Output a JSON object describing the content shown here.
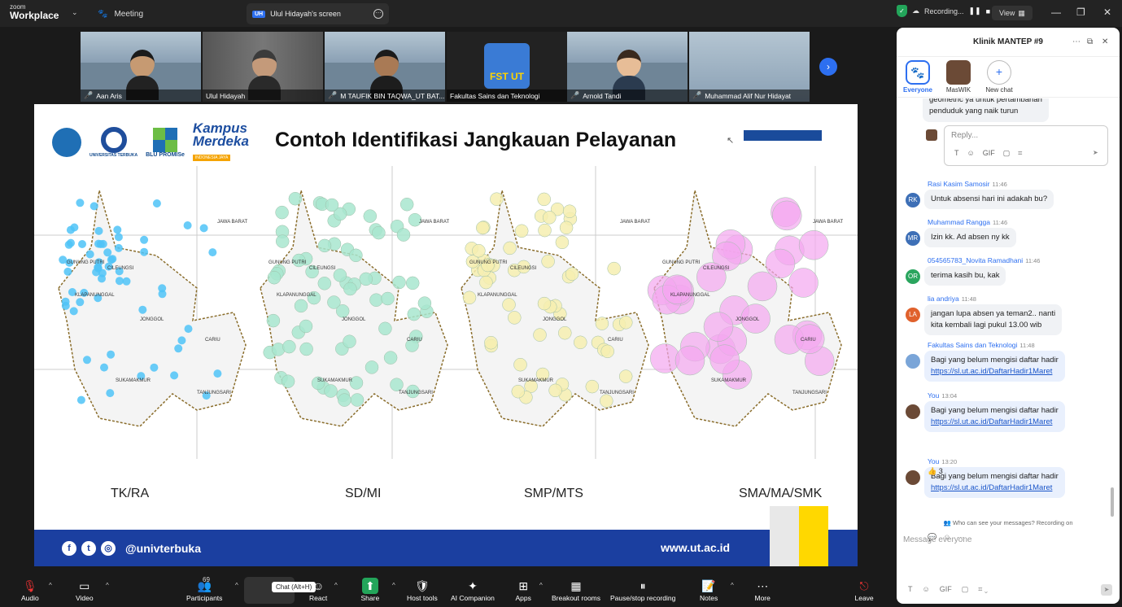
{
  "titlebar": {
    "logo_small": "zoom",
    "logo_big": "Workplace",
    "meeting_label": "Meeting",
    "screen_badge": "UH",
    "screen_tab": "Ulul Hidayah's screen",
    "recording_label": "Recording...",
    "view_label": "View",
    "icons": [
      "paw-icon",
      "shield-check-icon",
      "cloud-icon",
      "pause-icon",
      "stop-icon",
      "minimize-icon",
      "restore-icon",
      "close-icon"
    ]
  },
  "participants": [
    {
      "name": "Aan Aris",
      "muted": true
    },
    {
      "name": "Ulul Hidayah",
      "muted": false
    },
    {
      "name": "M TAUFIK BIN TAQWA_UT BAT...",
      "muted": true
    },
    {
      "name": "Fakultas Sains dan Teknologi",
      "muted": false
    },
    {
      "name": "Arnold Tandi",
      "muted": true
    },
    {
      "name": "Muhammad Alif Nur Hidayat",
      "muted": true
    }
  ],
  "fst_logo_text": "FST UT",
  "slide": {
    "title": "Contoh Identifikasi Jangkauan Pelayanan",
    "logo_labels": [
      "UNIVERSITAS TERBUKA",
      "BLU PROMISe"
    ],
    "kampus_logo": "Kampus",
    "merdeka_logo": "Merdeka",
    "kampus_sub": "INDONESIA JAYA",
    "map_labels": [
      "TK/RA",
      "SD/MI",
      "SMP/MTS",
      "SMA/MA/SMK"
    ],
    "footer_handle": "@univterbuka",
    "footer_web": "www.ut.ac.id",
    "place_names": [
      "GUNUNG PUTRI",
      "CILEUNGSI",
      "KLAPANUNGGAL",
      "JONGGOL",
      "CARIU",
      "SUKAMAKMUR",
      "TANJUNGSARI",
      "JAWA BARAT"
    ],
    "colors": {
      "tk": "#4fc3f7",
      "sd": "#a8e6cf",
      "smp": "#f6efb0",
      "sma": "#f4a6f0",
      "brand": "#1b3fa0"
    }
  },
  "chat": {
    "title": "Klinik MANTEP #9",
    "tabs": [
      {
        "label": "Everyone",
        "icon": "paw-icon",
        "active": true
      },
      {
        "label": "MasWIK",
        "icon": "avatar",
        "active": false
      },
      {
        "label": "New chat",
        "icon": "plus-icon",
        "active": false
      }
    ],
    "top_snippet_1": "geometric ya untuk pertambahan",
    "top_snippet_2": "penduduk yang naik turun",
    "reply_placeholder": "Reply...",
    "messages": [
      {
        "initials": "RK",
        "color": "#3d6fb6",
        "sender": "Rasi Kasim Samosir",
        "time": "11:46",
        "lines": [
          "Untuk absensi hari ini adakah bu?"
        ]
      },
      {
        "initials": "MR",
        "color": "#3d6fb6",
        "sender": "Muhammad Rangga",
        "time": "11:46",
        "lines": [
          "Izin kk. Ad absen ny kk"
        ]
      },
      {
        "initials": "OR",
        "color": "#2aa55e",
        "sender": "054565783_Novita Ramadhani",
        "time": "11:46",
        "lines": [
          "terima kasih bu, kak"
        ]
      },
      {
        "initials": "LA",
        "color": "#e0612c",
        "sender": "lia andriya",
        "time": "11:48",
        "lines": [
          "jangan lupa absen ya teman2.. nanti",
          "kita kembali lagi pukul 13.00 wib"
        ]
      },
      {
        "initials": "",
        "color": "#7aa5d8",
        "sender": "Fakultas Sains dan Teknologi",
        "time": "11:48",
        "lines": [
          "Bagi yang belum mengisi daftar hadir"
        ],
        "link": "https://sl.ut.ac.id/DaftarHadir1Maret"
      },
      {
        "initials": "",
        "color": "#6b4a36",
        "sender": "You",
        "time": "13:04",
        "lines": [
          "Bagi yang belum mengisi daftar hadir"
        ],
        "link": "https://sl.ut.ac.id/DaftarHadir1Maret"
      },
      {
        "initials": "",
        "color": "#6b4a36",
        "sender": "You",
        "time": "13:20",
        "lines": [
          "Bagi yang belum mengisi daftar hadir"
        ],
        "link": "https://sl.ut.ac.id/DaftarHadir1Maret"
      }
    ],
    "reaction": "👍 3",
    "who_can_see": "Who can see your messages? Recording on",
    "input_placeholder": "Message everyone"
  },
  "toolbar": {
    "items": [
      {
        "label": "Audio",
        "icon": "mic-off-icon"
      },
      {
        "label": "Video",
        "icon": "video-icon"
      },
      {
        "label": "Participants",
        "icon": "participants-icon",
        "count": "69"
      },
      {
        "label": "Chat",
        "icon": "chat-icon"
      },
      {
        "label": "React",
        "icon": "react-icon"
      },
      {
        "label": "Share",
        "icon": "share-icon"
      },
      {
        "label": "Host tools",
        "icon": "shield-icon"
      },
      {
        "label": "AI Companion",
        "icon": "sparkle-icon"
      },
      {
        "label": "Apps",
        "icon": "apps-icon"
      },
      {
        "label": "Breakout rooms",
        "icon": "grid-icon"
      },
      {
        "label": "Pause/stop recording",
        "icon": "pause-stop-icon"
      },
      {
        "label": "Notes",
        "icon": "notes-icon"
      },
      {
        "label": "More",
        "icon": "more-icon"
      },
      {
        "label": "Leave",
        "icon": "leave-icon"
      }
    ],
    "tooltip": "Chat (Alt+H)"
  }
}
